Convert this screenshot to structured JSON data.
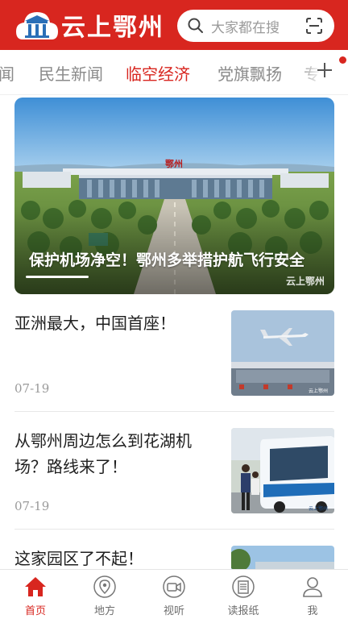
{
  "header": {
    "app_name": "云上鄂州",
    "search_placeholder": "大家都在搜",
    "brand_color": "#d8261f"
  },
  "tabs": [
    {
      "label": "闻",
      "active": false
    },
    {
      "label": "民生新闻",
      "active": false
    },
    {
      "label": "临空经济",
      "active": true
    },
    {
      "label": "党旗飘扬",
      "active": false
    },
    {
      "label": "专",
      "active": false
    }
  ],
  "hero": {
    "caption": "保护机场净空！鄂州多举措护航飞行安全",
    "building_sign": "鄂州",
    "watermark": "云上鄂州"
  },
  "news": [
    {
      "title": "亚洲最大，中国首座！",
      "date": "07-19",
      "thumb": "airplane-over-terminal",
      "watermark": "云上鄂州"
    },
    {
      "title": "从鄂州周边怎么到花湖机场？路线来了！",
      "date": "07-19",
      "thumb": "airport-shuttle-bus",
      "watermark": "云上鄂州"
    },
    {
      "title": "这家园区了不起！",
      "date": "",
      "thumb": "industrial-park"
    }
  ],
  "bottom_nav": [
    {
      "label": "首页",
      "icon": "home-icon",
      "active": true
    },
    {
      "label": "地方",
      "icon": "location-pin-icon",
      "active": false
    },
    {
      "label": "视听",
      "icon": "video-camera-icon",
      "active": false
    },
    {
      "label": "读报纸",
      "icon": "newspaper-icon",
      "active": false
    },
    {
      "label": "我",
      "icon": "user-icon",
      "active": false
    }
  ]
}
